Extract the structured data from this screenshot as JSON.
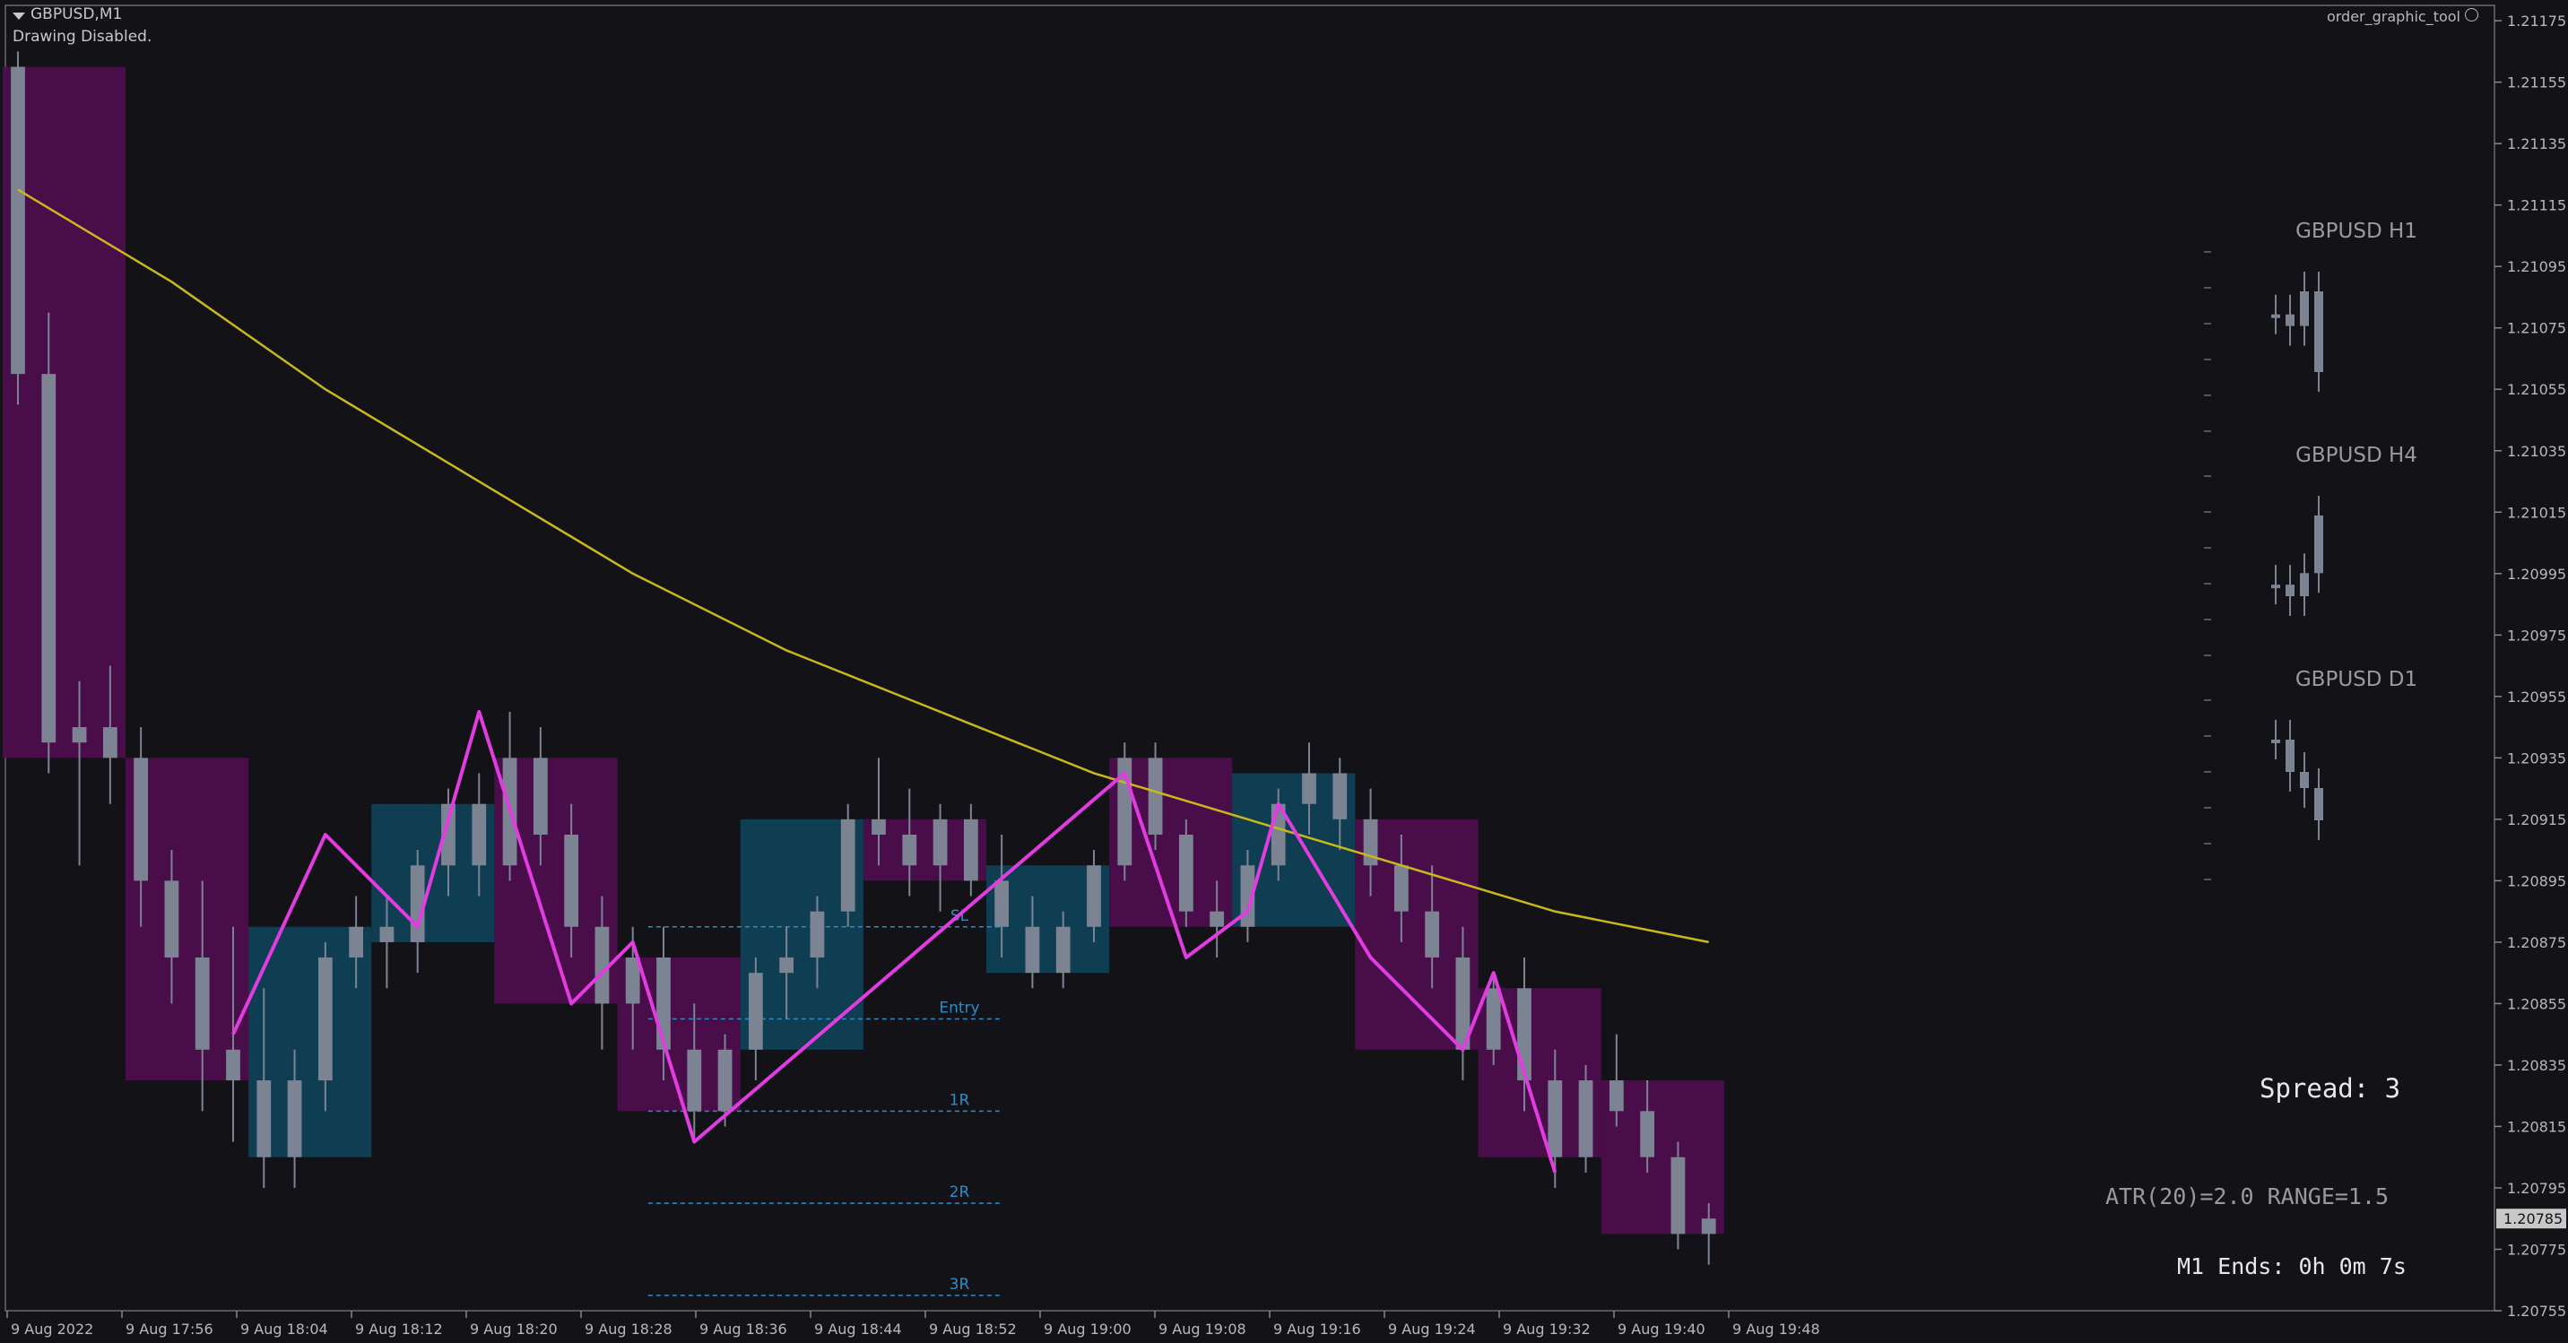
{
  "header": {
    "symbol": "GBPUSD,M1",
    "status": "Drawing Disabled.",
    "tool_name": "order_graphic_tool"
  },
  "info": {
    "spread": "Spread: 3",
    "atr": "ATR(20)=2.0   RANGE=1.5",
    "bar_end": "M1 Ends: 0h 0m 7s"
  },
  "colors": {
    "background": "#131317",
    "candle": "#7c8494",
    "ma": "#c8b81c",
    "zigzag": "#e03ce0",
    "bull_box": "#0f3f55",
    "bear_box": "#4c0d4c",
    "trade_line": "#2c8cc8",
    "price_tag": "#c8c8c8",
    "signal_arrow": "#3cd03c"
  },
  "chart_data": {
    "type": "candlestick",
    "symbol": "GBPUSD",
    "timeframe": "M1",
    "ylim": [
      1.20755,
      1.2118
    ],
    "y_ticks": [
      1.21175,
      1.21155,
      1.21135,
      1.21115,
      1.21095,
      1.21075,
      1.21055,
      1.21035,
      1.21015,
      1.20995,
      1.20975,
      1.20955,
      1.20935,
      1.20915,
      1.20895,
      1.20875,
      1.20855,
      1.20835,
      1.20815,
      1.20795,
      1.20775,
      1.20755
    ],
    "x_labels": [
      "9 Aug 2022",
      "9 Aug 17:56",
      "9 Aug 18:04",
      "9 Aug 18:12",
      "9 Aug 18:20",
      "9 Aug 18:28",
      "9 Aug 18:36",
      "9 Aug 18:44",
      "9 Aug 18:52",
      "9 Aug 19:00",
      "9 Aug 19:08",
      "9 Aug 19:16",
      "9 Aug 19:24",
      "9 Aug 19:32",
      "9 Aug 19:40",
      "9 Aug 19:48"
    ],
    "current_price": "1.20785",
    "candles": [
      [
        1.2116,
        1.21165,
        1.2105,
        1.2106
      ],
      [
        1.2106,
        1.2108,
        1.2093,
        1.2094
      ],
      [
        1.2094,
        1.2096,
        1.209,
        1.20945
      ],
      [
        1.20945,
        1.20965,
        1.2092,
        1.20935
      ],
      [
        1.20935,
        1.20945,
        1.2088,
        1.20895
      ],
      [
        1.20895,
        1.20905,
        1.20855,
        1.2087
      ],
      [
        1.2087,
        1.20895,
        1.2082,
        1.2084
      ],
      [
        1.2084,
        1.2088,
        1.2081,
        1.2083
      ],
      [
        1.2083,
        1.2086,
        1.20795,
        1.20805
      ],
      [
        1.20805,
        1.2084,
        1.20795,
        1.2083
      ],
      [
        1.2083,
        1.20875,
        1.2082,
        1.2087
      ],
      [
        1.2087,
        1.2089,
        1.2086,
        1.2088
      ],
      [
        1.2088,
        1.2089,
        1.2086,
        1.20875
      ],
      [
        1.20875,
        1.20905,
        1.20865,
        1.209
      ],
      [
        1.209,
        1.20925,
        1.2089,
        1.2092
      ],
      [
        1.2092,
        1.2093,
        1.2089,
        1.209
      ],
      [
        1.209,
        1.2095,
        1.20895,
        1.20935
      ],
      [
        1.20935,
        1.20945,
        1.209,
        1.2091
      ],
      [
        1.2091,
        1.2092,
        1.2087,
        1.2088
      ],
      [
        1.2088,
        1.2089,
        1.2084,
        1.20855
      ],
      [
        1.20855,
        1.2088,
        1.2084,
        1.2087
      ],
      [
        1.2087,
        1.2088,
        1.2083,
        1.2084
      ],
      [
        1.2084,
        1.20855,
        1.2081,
        1.2082
      ],
      [
        1.2082,
        1.20845,
        1.20815,
        1.2084
      ],
      [
        1.2084,
        1.2087,
        1.2083,
        1.20865
      ],
      [
        1.20865,
        1.2088,
        1.2085,
        1.2087
      ],
      [
        1.2087,
        1.2089,
        1.2086,
        1.20885
      ],
      [
        1.20885,
        1.2092,
        1.2088,
        1.20915
      ],
      [
        1.20915,
        1.20935,
        1.209,
        1.2091
      ],
      [
        1.2091,
        1.20925,
        1.2089,
        1.209
      ],
      [
        1.209,
        1.2092,
        1.20885,
        1.20915
      ],
      [
        1.20915,
        1.2092,
        1.2089,
        1.20895
      ],
      [
        1.20895,
        1.2091,
        1.2087,
        1.2088
      ],
      [
        1.2088,
        1.2089,
        1.2086,
        1.20865
      ],
      [
        1.20865,
        1.20885,
        1.2086,
        1.2088
      ],
      [
        1.2088,
        1.20905,
        1.20875,
        1.209
      ],
      [
        1.209,
        1.2094,
        1.20895,
        1.20935
      ],
      [
        1.20935,
        1.2094,
        1.20905,
        1.2091
      ],
      [
        1.2091,
        1.20915,
        1.2088,
        1.20885
      ],
      [
        1.20885,
        1.20895,
        1.2087,
        1.2088
      ],
      [
        1.2088,
        1.20905,
        1.20875,
        1.209
      ],
      [
        1.209,
        1.20925,
        1.20895,
        1.2092
      ],
      [
        1.2092,
        1.2094,
        1.2091,
        1.2093
      ],
      [
        1.2093,
        1.20935,
        1.20905,
        1.20915
      ],
      [
        1.20915,
        1.20925,
        1.2089,
        1.209
      ],
      [
        1.209,
        1.2091,
        1.20875,
        1.20885
      ],
      [
        1.20885,
        1.209,
        1.2086,
        1.2087
      ],
      [
        1.2087,
        1.2088,
        1.2083,
        1.2084
      ],
      [
        1.2084,
        1.20865,
        1.20835,
        1.2086
      ],
      [
        1.2086,
        1.2087,
        1.2082,
        1.2083
      ],
      [
        1.2083,
        1.2084,
        1.20795,
        1.20805
      ],
      [
        1.20805,
        1.20835,
        1.208,
        1.2083
      ],
      [
        1.2083,
        1.20845,
        1.20815,
        1.2082
      ],
      [
        1.2082,
        1.2083,
        1.208,
        1.20805
      ],
      [
        1.20805,
        1.2081,
        1.20775,
        1.2078
      ],
      [
        1.2078,
        1.2079,
        1.2077,
        1.20785
      ]
    ],
    "ma_line": {
      "name": "",
      "points": [
        [
          0,
          1.2112
        ],
        [
          5,
          1.2109
        ],
        [
          10,
          1.21055
        ],
        [
          15,
          1.21025
        ],
        [
          20,
          1.20995
        ],
        [
          25,
          1.2097
        ],
        [
          30,
          1.2095
        ],
        [
          35,
          1.2093
        ],
        [
          40,
          1.20915
        ],
        [
          45,
          1.209
        ],
        [
          50,
          1.20885
        ],
        [
          55,
          1.20875
        ]
      ]
    },
    "zigzag": [
      [
        7,
        1.20845
      ],
      [
        10,
        1.2091
      ],
      [
        13,
        1.2088
      ],
      [
        15,
        1.2095
      ],
      [
        18,
        1.20855
      ],
      [
        20,
        1.20875
      ],
      [
        22,
        1.2081
      ],
      [
        36,
        1.2093
      ],
      [
        38,
        1.2087
      ],
      [
        40,
        1.20885
      ],
      [
        41,
        1.2092
      ],
      [
        44,
        1.2087
      ],
      [
        47,
        1.2084
      ],
      [
        48,
        1.20865
      ],
      [
        50,
        1.208
      ]
    ],
    "trade_levels": [
      {
        "label": "SL",
        "price": 1.2088
      },
      {
        "label": "Entry",
        "price": 1.2085
      },
      {
        "label": "1R",
        "price": 1.2082
      },
      {
        "label": "2R",
        "price": 1.2079
      },
      {
        "label": "3R",
        "price": 1.2076
      }
    ],
    "mini_charts": [
      {
        "label": "GBPUSD H1",
        "closes": [
          1.2108,
          1.21075,
          1.2109,
          1.21055
        ]
      },
      {
        "label": "GBPUSD H4",
        "closes": [
          1.2098,
          1.20975,
          1.20985,
          1.2101
        ]
      },
      {
        "label": "GBPUSD D1",
        "closes": [
          1.2093,
          1.2092,
          1.20915,
          1.20905
        ]
      }
    ]
  }
}
